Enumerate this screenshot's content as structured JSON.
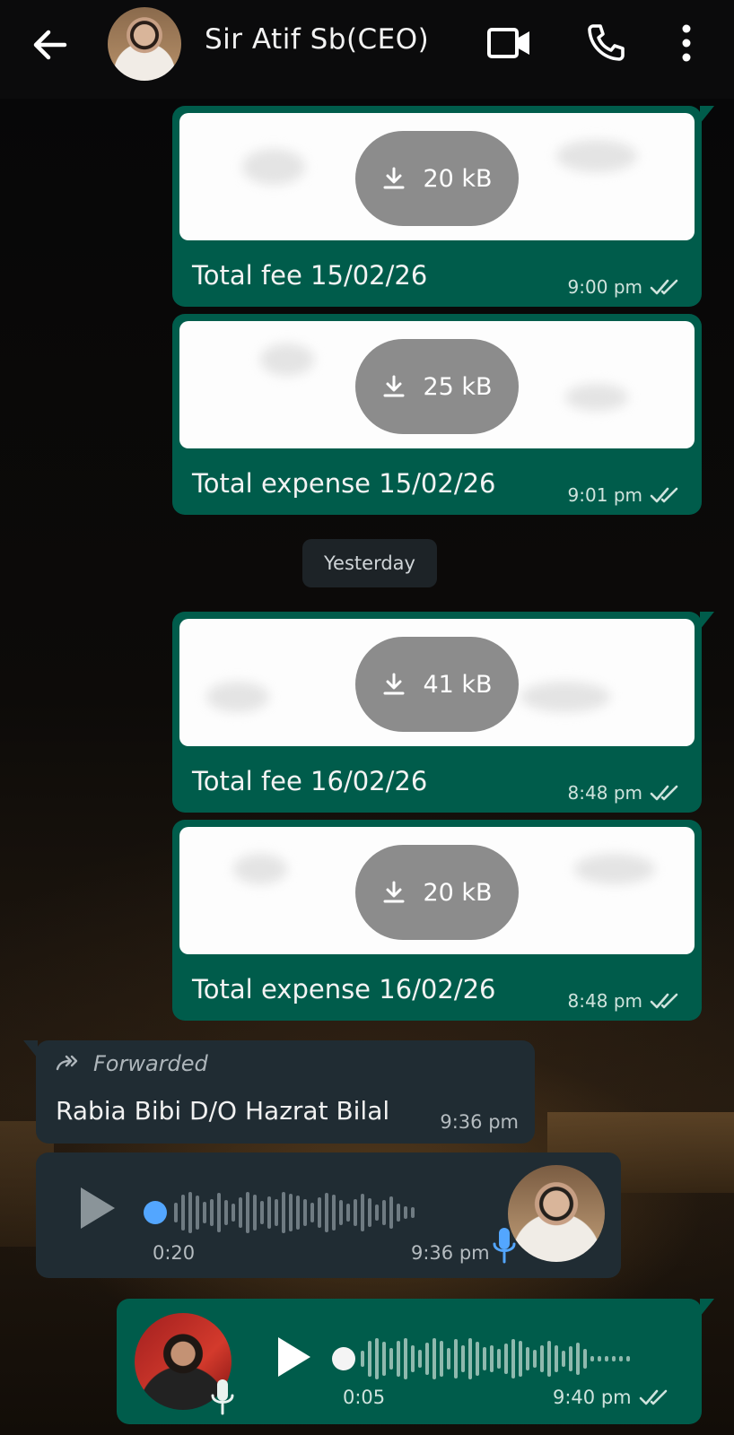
{
  "header": {
    "contact_name": "Sir Atif Sb(CEO)",
    "icons": [
      "back-arrow-icon",
      "video-call-icon",
      "voice-call-icon",
      "more-options-icon"
    ]
  },
  "messages": [
    {
      "type": "document",
      "direction": "out",
      "size": "20 kB",
      "caption": "Total fee 15/02/26",
      "time": "9:00 pm",
      "status": "read"
    },
    {
      "type": "document",
      "direction": "out",
      "size": "25 kB",
      "caption": "Total expense 15/02/26",
      "time": "9:01 pm",
      "status": "read"
    },
    {
      "type": "date_separator",
      "label": "Yesterday"
    },
    {
      "type": "document",
      "direction": "out",
      "size": "41 kB",
      "caption": "Total fee 16/02/26",
      "time": "8:48 pm",
      "status": "read"
    },
    {
      "type": "document",
      "direction": "out",
      "size": "20 kB",
      "caption": "Total expense 16/02/26",
      "time": "8:48 pm",
      "status": "read"
    },
    {
      "type": "text",
      "direction": "in",
      "forwarded_label": "Forwarded",
      "text": "Rabia Bibi D/O Hazrat Bilal",
      "time": "9:36 pm"
    },
    {
      "type": "voice",
      "direction": "in",
      "duration": "0:20",
      "time": "9:36 pm",
      "progress": 0
    },
    {
      "type": "voice",
      "direction": "out",
      "duration": "0:05",
      "time": "9:40 pm",
      "status": "read",
      "progress": 0
    }
  ],
  "colors": {
    "outgoing_bubble": "#005c4b",
    "incoming_bubble": "#202c33",
    "header_bg": "#0b0b0c",
    "playhead_in": "#53a6ff",
    "read_ticks": "#cfe3dd"
  }
}
